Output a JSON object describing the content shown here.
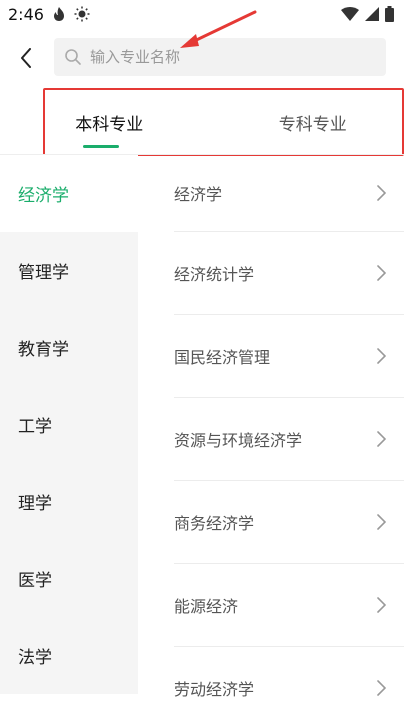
{
  "status_bar": {
    "time": "2:46",
    "left_icons": [
      "flame-icon",
      "brightness-icon"
    ],
    "right_icons": [
      "wifi-icon",
      "signal-icon",
      "battery-icon"
    ]
  },
  "header": {
    "back_icon": "chevron-left-icon",
    "search_placeholder": "输入专业名称",
    "search_icon": "search-icon"
  },
  "tabs": [
    {
      "label": "本科专业",
      "active": true
    },
    {
      "label": "专科专业",
      "active": false
    }
  ],
  "sidebar": {
    "items": [
      {
        "label": "经济学",
        "active": true
      },
      {
        "label": "管理学",
        "active": false
      },
      {
        "label": "教育学",
        "active": false
      },
      {
        "label": "工学",
        "active": false
      },
      {
        "label": "理学",
        "active": false
      },
      {
        "label": "医学",
        "active": false
      },
      {
        "label": "法学",
        "active": false
      }
    ]
  },
  "majors": [
    "经济学",
    "经济统计学",
    "国民经济管理",
    "资源与环境经济学",
    "商务经济学",
    "能源经济",
    "劳动经济学"
  ],
  "colors": {
    "accent": "#1aad6b",
    "annotation": "#e53935",
    "sidebar_bg": "#f5f5f5"
  }
}
